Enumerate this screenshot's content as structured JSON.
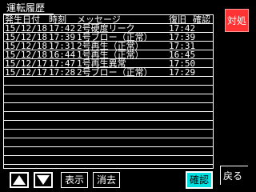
{
  "header": {
    "title": "運転履歴"
  },
  "table": {
    "columns": [
      "発生日付",
      "時刻",
      "メッセージ",
      "復旧",
      "確認"
    ],
    "rows": [
      [
        "15/12/18",
        "17:42",
        "2号硬度リーク",
        "17:42",
        ""
      ],
      [
        "15/12/18",
        "17:39",
        "1号ブロー（正常）",
        "17:39",
        ""
      ],
      [
        "15/12/18",
        "17:31",
        "2号再生（正常）",
        "17:31",
        ""
      ],
      [
        "15/12/18",
        "16:44",
        "1号再生（正常）",
        "16:45",
        ""
      ],
      [
        "15/12/17",
        "17:47",
        "1号再生異常",
        "17:50",
        ""
      ],
      [
        "15/12/17",
        "17:28",
        "2号ブロー（正常）",
        "17:29",
        ""
      ],
      [
        "",
        "",
        "",
        "",
        ""
      ],
      [
        "",
        "",
        "",
        "",
        ""
      ],
      [
        "",
        "",
        "",
        "",
        ""
      ],
      [
        "",
        "",
        "",
        "",
        ""
      ],
      [
        "",
        "",
        "",
        "",
        ""
      ],
      [
        "",
        "",
        "",
        "",
        ""
      ],
      [
        "",
        "",
        "",
        "",
        ""
      ],
      [
        "",
        "",
        "",
        "",
        ""
      ],
      [
        "",
        "",
        "",
        "",
        ""
      ],
      [
        "",
        "",
        "",
        "",
        ""
      ]
    ]
  },
  "buttons": {
    "action": "対処",
    "up_icon": "triangle-up-icon",
    "down_icon": "triangle-down-icon",
    "view": "表示",
    "clear": "消去",
    "confirm": "確認",
    "back": "戻る"
  },
  "colors": {
    "background": "#000000",
    "text": "#ffffff",
    "action_button": "#ff3333",
    "confirm_button": "#00e0e0"
  }
}
